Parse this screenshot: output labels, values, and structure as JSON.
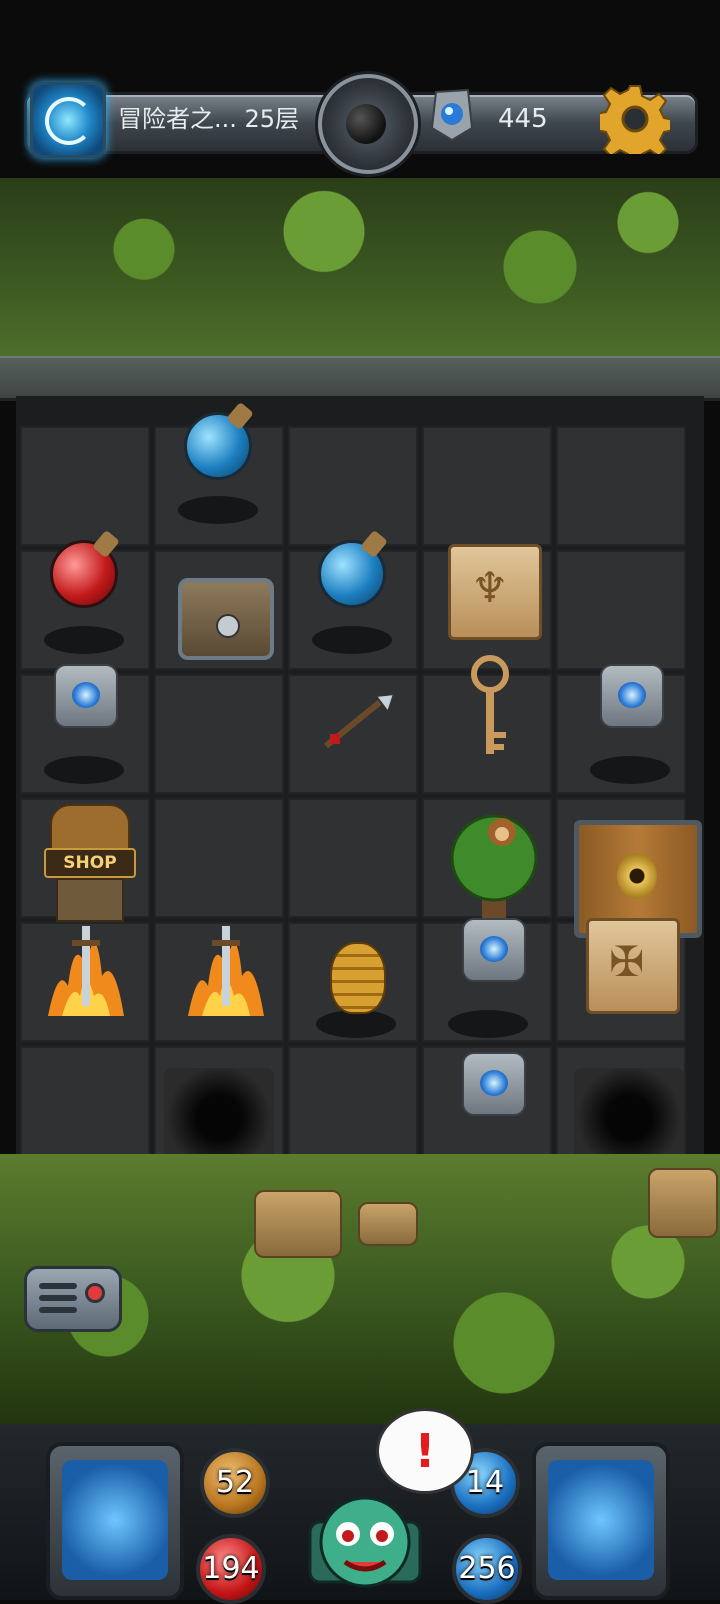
{
  "header": {
    "level_title": "冒险者之... 25层",
    "gem_count": "445",
    "icons": [
      "portal-icon",
      "bomb-icon",
      "gem-icon",
      "settings-gear-icon"
    ]
  },
  "board": {
    "items": [
      "blue-potion",
      "red-potion",
      "treasure-chest",
      "scroll",
      "gem",
      "spear",
      "key",
      "shop",
      "flaming-sword",
      "beehive",
      "monkey-tree",
      "locked-door",
      "pit"
    ],
    "shop_label": "SHOP"
  },
  "hud": {
    "attack": "52",
    "hp": "194",
    "defense": "14",
    "mp": "256",
    "alert_symbol": "!"
  },
  "colors": {
    "accent_gold": "#c99a3c",
    "hp_red": "#c41616",
    "mana_blue": "#1a6fbf"
  }
}
